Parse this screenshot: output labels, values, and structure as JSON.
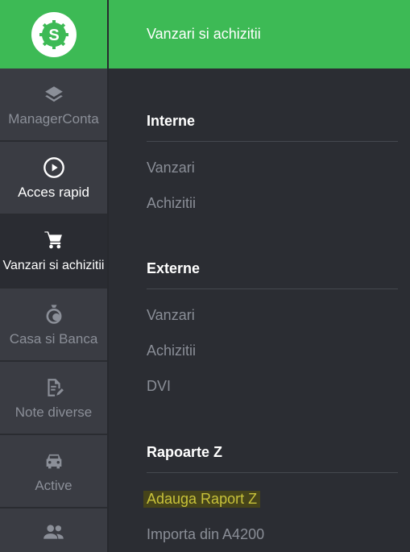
{
  "app": {
    "logo_icon": "dollar-gear-icon",
    "brand_color": "#3dba55"
  },
  "sidebar": {
    "items": [
      {
        "label": "ManagerConta",
        "icon": "layers-icon",
        "state": "normal"
      },
      {
        "label": "Acces rapid",
        "icon": "play-circle-icon",
        "state": "highlight"
      },
      {
        "label": "Vanzari si achizitii",
        "icon": "shopping-cart-icon",
        "state": "active"
      },
      {
        "label": "Casa si Banca",
        "icon": "coins-icon",
        "state": "normal"
      },
      {
        "label": "Note diverse",
        "icon": "edit-document-icon",
        "state": "normal"
      },
      {
        "label": "Active",
        "icon": "car-icon",
        "state": "normal"
      },
      {
        "label": "",
        "icon": "people-icon",
        "state": "normal"
      }
    ]
  },
  "header": {
    "title": "Vanzari si achizitii"
  },
  "sections": [
    {
      "title": "Interne",
      "links": [
        "Vanzari",
        "Achizitii"
      ]
    },
    {
      "title": "Externe",
      "links": [
        "Vanzari",
        "Achizitii",
        "DVI"
      ]
    },
    {
      "title": "Rapoarte Z",
      "links": [
        "Adauga Raport Z",
        "Importa din A4200"
      ]
    }
  ]
}
